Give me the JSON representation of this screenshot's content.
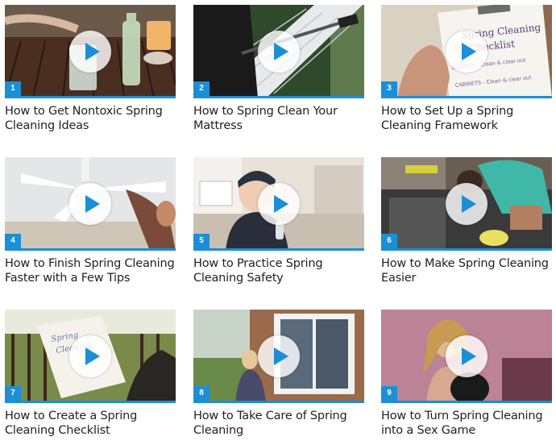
{
  "videos": [
    {
      "number": "1",
      "title": "How to Get Nontoxic Spring Cleaning Ideas",
      "thumb_icon": "tabletop-bottles-thumbnail"
    },
    {
      "number": "2",
      "title": "How to Spring Clean Your Mattress",
      "thumb_icon": "mattress-vacuum-thumbnail"
    },
    {
      "number": "3",
      "title": "How to Set Up a Spring Cleaning Framework",
      "thumb_icon": "checklist-clipboard-thumbnail",
      "thumb_text": [
        "Spring Cleaning",
        "Checklist",
        "CLOSETS - Clean & clear out",
        "CABINETS - Clean & clear out"
      ]
    },
    {
      "number": "4",
      "title": "How to Finish Spring Cleaning Faster with a Few Tips",
      "thumb_icon": "ceiling-fan-thumbnail"
    },
    {
      "number": "5",
      "title": "How to Practice Spring Cleaning Safety",
      "thumb_icon": "woman-kitchen-thumbnail"
    },
    {
      "number": "6",
      "title": "How to Make Spring Cleaning Easier",
      "thumb_icon": "man-cleaning-thumbnail"
    },
    {
      "number": "7",
      "title": "How to Create a Spring Cleaning Checklist",
      "thumb_icon": "writing-clipboard-thumbnail",
      "thumb_text": [
        "Spring",
        "Cleaning"
      ]
    },
    {
      "number": "8",
      "title": "How to Take Care of Spring Cleaning",
      "thumb_icon": "window-cleaning-thumbnail"
    },
    {
      "number": "9",
      "title": "How to Turn Spring Cleaning into a Sex Game",
      "thumb_icon": "couple-room-thumbnail"
    }
  ],
  "colors": {
    "accent": "#1a8fd8",
    "title_text": "#222222"
  }
}
